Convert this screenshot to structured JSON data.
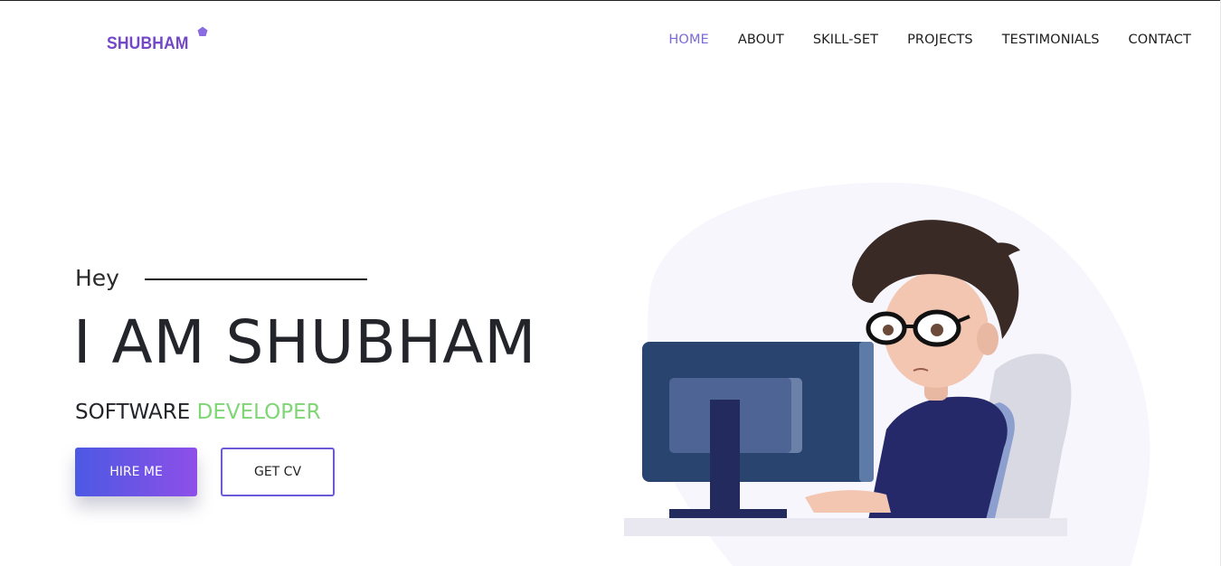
{
  "brand": {
    "logo_text": "SHUBHAM",
    "logo_icon": "pentagon-star-icon",
    "color": "#7348c8"
  },
  "nav": {
    "items": [
      {
        "label": "HOME",
        "active": true
      },
      {
        "label": "ABOUT",
        "active": false
      },
      {
        "label": "SKILL-SET",
        "active": false
      },
      {
        "label": "PROJECTS",
        "active": false
      },
      {
        "label": "TESTIMONIALS",
        "active": false
      },
      {
        "label": "CONTACT",
        "active": false
      }
    ],
    "active_color": "#7a6ad8"
  },
  "hero": {
    "greeting": "Hey",
    "headline": "I AM SHUBHAM",
    "role_prefix": "SOFTWARE",
    "role_accent": "DEVELOPER",
    "accent_color": "#7fd675",
    "hire_button": "HIRE ME",
    "cv_button": "GET CV",
    "illustration": "developer-at-computer-illustration"
  }
}
